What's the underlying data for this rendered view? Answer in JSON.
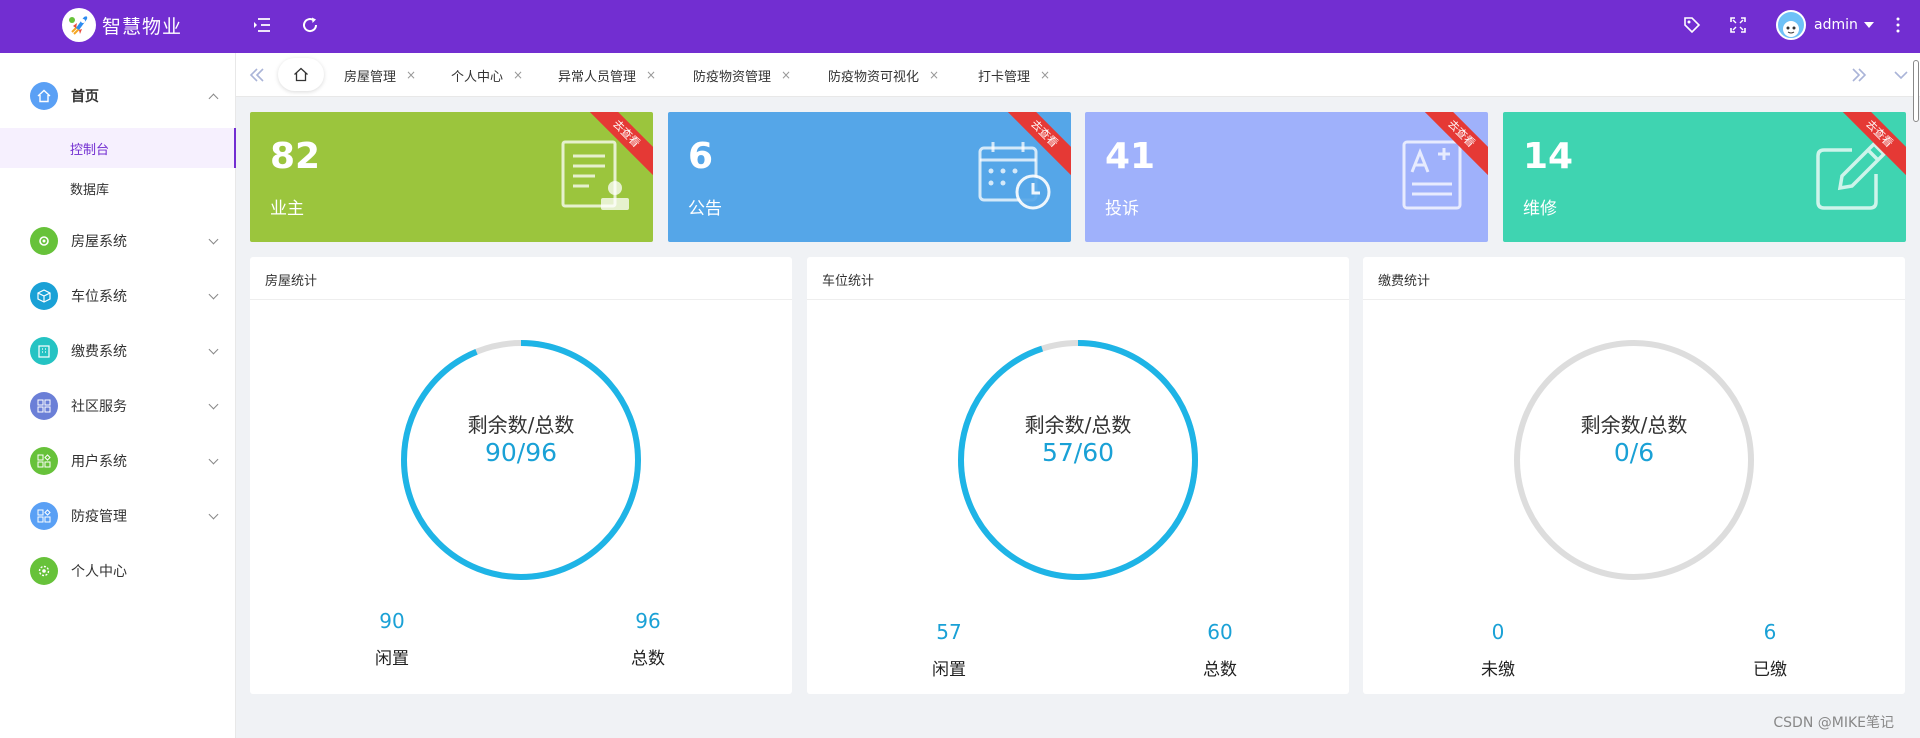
{
  "app": {
    "title": "智慧物业"
  },
  "header": {
    "user_name": "admin"
  },
  "sidebar": {
    "items": [
      {
        "label": "首页",
        "icon": "home-icon",
        "color": "#5aa0f5"
      },
      {
        "label": "房屋系统",
        "icon": "settings-icon",
        "color": "#67c23a"
      },
      {
        "label": "车位系统",
        "icon": "box-icon",
        "color": "#1aa1d6"
      },
      {
        "label": "缴费系统",
        "icon": "building-icon",
        "color": "#25c3c3"
      },
      {
        "label": "社区服务",
        "icon": "grid-icon",
        "color": "#6b7fd7"
      },
      {
        "label": "用户系统",
        "icon": "apps-icon",
        "color": "#67c23a"
      },
      {
        "label": "防疫管理",
        "icon": "apps-icon",
        "color": "#5aa0f5"
      },
      {
        "label": "个人中心",
        "icon": "gear-icon",
        "color": "#67c23a"
      }
    ],
    "subitems": [
      {
        "label": "控制台"
      },
      {
        "label": "数据库"
      }
    ]
  },
  "tabs": [
    {
      "label": "房屋管理"
    },
    {
      "label": "个人中心"
    },
    {
      "label": "异常人员管理"
    },
    {
      "label": "防疫物资管理"
    },
    {
      "label": "防疫物资可视化"
    },
    {
      "label": "打卡管理"
    }
  ],
  "tab_close_glyph": "×",
  "cards": [
    {
      "value": "82",
      "label": "业主",
      "ribbon": "去查看",
      "color": "#9bc53d",
      "icon": "document-user-icon"
    },
    {
      "value": "6",
      "label": "公告",
      "ribbon": "去查看",
      "color": "#55a6e8",
      "icon": "calendar-clock-icon"
    },
    {
      "value": "41",
      "label": "投诉",
      "ribbon": "去查看",
      "color": "#9fb1fb",
      "icon": "document-edit-icon"
    },
    {
      "value": "14",
      "label": "维修",
      "ribbon": "去查看",
      "color": "#3fd4b1",
      "icon": "edit-icon"
    }
  ],
  "panels": [
    {
      "title": "房屋统计",
      "caption": "剩余数/总数",
      "ratio": "90/96",
      "left_value": "90",
      "left_label": "闲置",
      "right_value": "96",
      "right_label": "总数",
      "remaining": 90,
      "total": 96
    },
    {
      "title": "车位统计",
      "caption": "剩余数/总数",
      "ratio": "57/60",
      "left_value": "57",
      "left_label": "闲置",
      "right_value": "60",
      "right_label": "总数",
      "remaining": 57,
      "total": 60
    },
    {
      "title": "缴费统计",
      "caption": "剩余数/总数",
      "ratio": "0/6",
      "left_value": "0",
      "left_label": "未缴",
      "right_value": "6",
      "right_label": "已缴",
      "remaining": 0,
      "total": 6
    }
  ],
  "watermark": "CSDN @MIKE笔记",
  "colors": {
    "brand": "#722ed1",
    "ring": "#1eb4e6",
    "ring_track": "#dddddd"
  }
}
